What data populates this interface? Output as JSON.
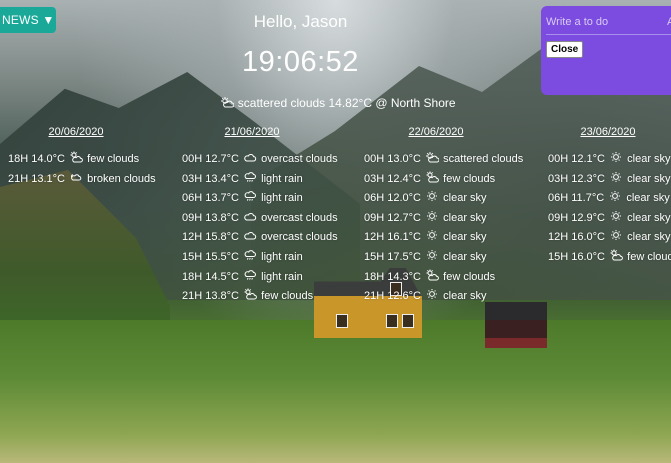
{
  "header": {
    "news_label": "NEWS ▼",
    "greeting": "Hello, Jason",
    "time": "19:06:52",
    "current_weather": "scattered clouds 14.82°C @ North Shore",
    "current_icon": "partly-cloudy-icon"
  },
  "todo": {
    "placeholder": "Write a to do",
    "overflow_text": "A",
    "close_label": "Close",
    "accent": "#7c4be0"
  },
  "forecast": [
    {
      "date": "20/06/2020",
      "entries": [
        {
          "time": "18H",
          "temp": "14.0°C",
          "icon": "sun-cloud-icon",
          "desc": "few clouds"
        },
        {
          "time": "21H",
          "temp": "13.1°C",
          "icon": "broken-clouds-icon",
          "desc": "broken clouds"
        }
      ]
    },
    {
      "date": "21/06/2020",
      "entries": [
        {
          "time": "00H",
          "temp": "12.7°C",
          "icon": "cloud-icon",
          "desc": "overcast clouds"
        },
        {
          "time": "03H",
          "temp": "13.4°C",
          "icon": "rain-icon",
          "desc": "light rain"
        },
        {
          "time": "06H",
          "temp": "13.7°C",
          "icon": "rain-icon",
          "desc": "light rain"
        },
        {
          "time": "09H",
          "temp": "13.8°C",
          "icon": "cloud-icon",
          "desc": "overcast clouds"
        },
        {
          "time": "12H",
          "temp": "15.8°C",
          "icon": "cloud-icon",
          "desc": "overcast clouds"
        },
        {
          "time": "15H",
          "temp": "15.5°C",
          "icon": "rain-icon",
          "desc": "light rain"
        },
        {
          "time": "18H",
          "temp": "14.5°C",
          "icon": "rain-icon",
          "desc": "light rain"
        },
        {
          "time": "21H",
          "temp": "13.8°C",
          "icon": "sun-cloud-icon",
          "desc": "few clouds"
        }
      ]
    },
    {
      "date": "22/06/2020",
      "entries": [
        {
          "time": "00H",
          "temp": "13.0°C",
          "icon": "partly-cloudy-icon",
          "desc": "scattered clouds"
        },
        {
          "time": "03H",
          "temp": "12.4°C",
          "icon": "sun-cloud-icon",
          "desc": "few clouds"
        },
        {
          "time": "06H",
          "temp": "12.0°C",
          "icon": "sun-icon",
          "desc": "clear sky"
        },
        {
          "time": "09H",
          "temp": "12.7°C",
          "icon": "sun-icon",
          "desc": "clear sky"
        },
        {
          "time": "12H",
          "temp": "16.1°C",
          "icon": "sun-icon",
          "desc": "clear sky"
        },
        {
          "time": "15H",
          "temp": "17.5°C",
          "icon": "sun-icon",
          "desc": "clear sky"
        },
        {
          "time": "18H",
          "temp": "14.3°C",
          "icon": "sun-cloud-icon",
          "desc": "few clouds"
        },
        {
          "time": "21H",
          "temp": "12.6°C",
          "icon": "sun-icon",
          "desc": "clear sky"
        }
      ]
    },
    {
      "date": "23/06/2020",
      "entries": [
        {
          "time": "00H",
          "temp": "12.1°C",
          "icon": "sun-icon",
          "desc": "clear sky"
        },
        {
          "time": "03H",
          "temp": "12.3°C",
          "icon": "sun-icon",
          "desc": "clear sky"
        },
        {
          "time": "06H",
          "temp": "11.7°C",
          "icon": "sun-icon",
          "desc": "clear sky"
        },
        {
          "time": "09H",
          "temp": "12.9°C",
          "icon": "sun-icon",
          "desc": "clear sky"
        },
        {
          "time": "12H",
          "temp": "16.0°C",
          "icon": "sun-icon",
          "desc": "clear sky"
        },
        {
          "time": "15H",
          "temp": "16.0°C",
          "icon": "sun-cloud-icon",
          "desc": "few clouds"
        }
      ]
    }
  ]
}
